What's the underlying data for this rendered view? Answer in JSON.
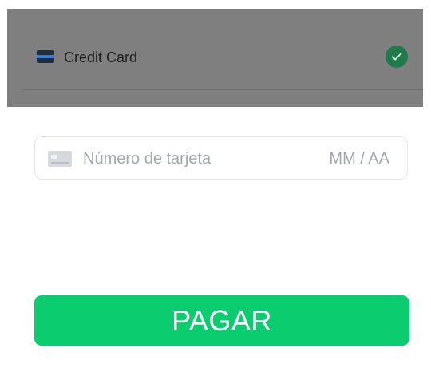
{
  "payment_method": {
    "label": "Credit Card",
    "selected": true,
    "icon": "credit-card-icon",
    "check_icon": "check-circle-icon"
  },
  "card_form": {
    "card_icon": "card-placeholder-icon",
    "number_placeholder": "Número de tarjeta",
    "number_value": "",
    "expiry_placeholder": "MM / AA",
    "expiry_value": ""
  },
  "pay_button": {
    "label": "PAGAR"
  },
  "colors": {
    "overlay": "#7f7f7f",
    "check": "#217a49",
    "button": "#0ccc70",
    "placeholder": "#a4a8ad"
  }
}
